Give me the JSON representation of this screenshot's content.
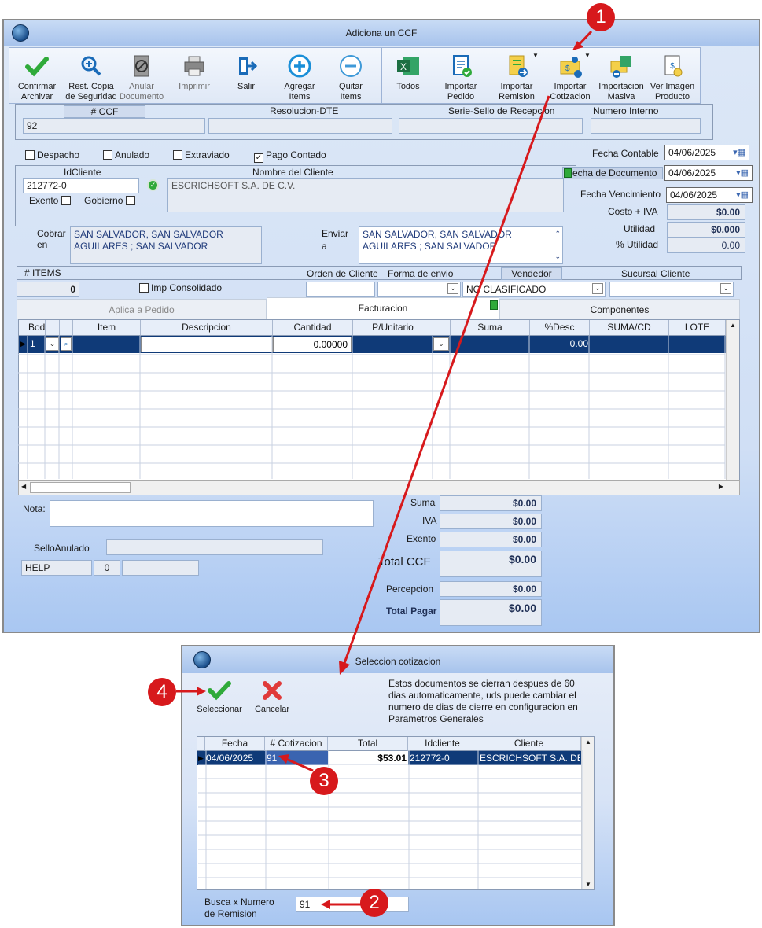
{
  "main_window": {
    "title": "Adiciona un CCF",
    "toolbar_left": [
      {
        "label": "Confirmar\nArchivar",
        "icon": "check-icon"
      },
      {
        "label": "Rest. Copia\nde Seguridad",
        "icon": "zoom-icon"
      },
      {
        "label": "Anular\nDocumento",
        "icon": "void-icon"
      },
      {
        "label": "Imprimir",
        "icon": "printer-icon"
      },
      {
        "label": "Salir",
        "icon": "exit-icon"
      },
      {
        "label": "Agregar\nItems",
        "icon": "plus-circle-icon"
      },
      {
        "label": "Quitar\nItems",
        "icon": "minus-circle-icon"
      }
    ],
    "toolbar_right": [
      {
        "label": "Todos",
        "icon": "excel-icon"
      },
      {
        "label": "Importar\nPedido",
        "icon": "order-icon"
      },
      {
        "label": "Importar\nRemision",
        "icon": "remision-icon"
      },
      {
        "label": "Importar\nCotizacion",
        "icon": "quote-icon"
      },
      {
        "label": "Importacion\nMasiva",
        "icon": "mass-import-icon"
      },
      {
        "label": "Ver Imagen\nProducto",
        "icon": "product-image-icon"
      }
    ],
    "header": {
      "ccf_label": "# CCF",
      "ccf_value": "92",
      "resolucion_label": "Resolucion-DTE",
      "serie_label": "Serie-Sello de Recepcion",
      "numero_interno_label": "Numero Interno"
    },
    "checkboxes": {
      "despacho": "Despacho",
      "anulado": "Anulado",
      "extraviado": "Extraviado",
      "pago_contado": "Pago Contado"
    },
    "fechas": {
      "contable_label": "Fecha Contable",
      "contable": "04/06/2025",
      "documento_label": "echa de  Documento",
      "documento": "04/06/2025",
      "vencimiento_label": "Fecha Vencimiento",
      "vencimiento": "04/06/2025"
    },
    "cliente": {
      "id_label": "IdCliente",
      "id": "212772-0",
      "nombre_label": "Nombre del Cliente",
      "nombre": "ESCRICHSOFT S.A. DE C.V.",
      "exento": "Exento",
      "gobierno": "Gobierno"
    },
    "costos": {
      "costo_iva_label": "Costo + IVA",
      "costo_iva": "$0.00",
      "utilidad_label": "Utilidad",
      "utilidad": "$0.000",
      "pct_label": "% Utilidad",
      "pct": "0.00"
    },
    "cobrar": {
      "label1": "Cobrar",
      "label2": "en",
      "line1": "SAN SALVADOR, SAN SALVADOR",
      "line2": "AGUILARES ; SAN SALVADOR"
    },
    "enviar": {
      "label1": "Enviar",
      "label2": "a",
      "line1": "SAN SALVADOR, SAN SALVADOR",
      "line2": "AGUILARES ; SAN SALVADOR"
    },
    "row_info": {
      "items_label": "# ITEMS",
      "items": "0",
      "imp_consolidado": "Imp Consolidado",
      "orden_label": "Orden de Cliente",
      "forma_label": "Forma de envio",
      "vendedor_label": "Vendedor",
      "vendedor": "NO CLASIFICADO",
      "sucursal_label": "Sucursal Cliente"
    },
    "tabs": [
      "Aplica a Pedido",
      "Facturacion",
      "Componentes"
    ],
    "grid": {
      "columns": [
        "Bodega",
        "Item",
        "Descripcion",
        "Cantidad",
        "P/Unitario",
        "Suma",
        "%Desc",
        "SUMA/CD",
        "LOTE"
      ],
      "row": {
        "bodega": "1",
        "cantidad": "0.00000",
        "desc": "0.00"
      }
    },
    "footer": {
      "nota_label": "Nota:",
      "sello_label": "SelloAnulado",
      "help": "HELP",
      "help_num": "0",
      "suma_label": "Suma",
      "suma": "$0.00",
      "iva_label": "IVA",
      "iva": "$0.00",
      "exento_label": "Exento",
      "exento": "$0.00",
      "total_ccf_label": "Total CCF",
      "total_ccf": "$0.00",
      "percepcion_label": "Percepcion",
      "percepcion": "$0.00",
      "total_pagar_label": "Total Pagar",
      "total_pagar": "$0.00"
    }
  },
  "dialog": {
    "title": "Seleccion cotizacion",
    "seleccionar": "Seleccionar",
    "cancelar": "Cancelar",
    "info": "Estos documentos se cierran despues de 60 dias automaticamente, uds puede cambiar el numero de dias de cierre en configuracion en Parametros Generales",
    "columns": [
      "Fecha",
      "# Cotizacion",
      "Total",
      "Idcliente",
      "Cliente"
    ],
    "row": {
      "fecha": "04/06/2025",
      "cotizacion": "91",
      "total": "$53.01",
      "idcliente": "212772-0",
      "cliente": "ESCRICHSOFT S.A. DE"
    },
    "busca_label1": "Busca x Numero",
    "busca_label2": "de Remision",
    "busca_value": "91"
  },
  "annotations": [
    "1",
    "2",
    "3",
    "4"
  ],
  "colors": {
    "accent": "#0f3a78",
    "annotation": "#d7191c",
    "window_bg": "#d0dff5"
  }
}
